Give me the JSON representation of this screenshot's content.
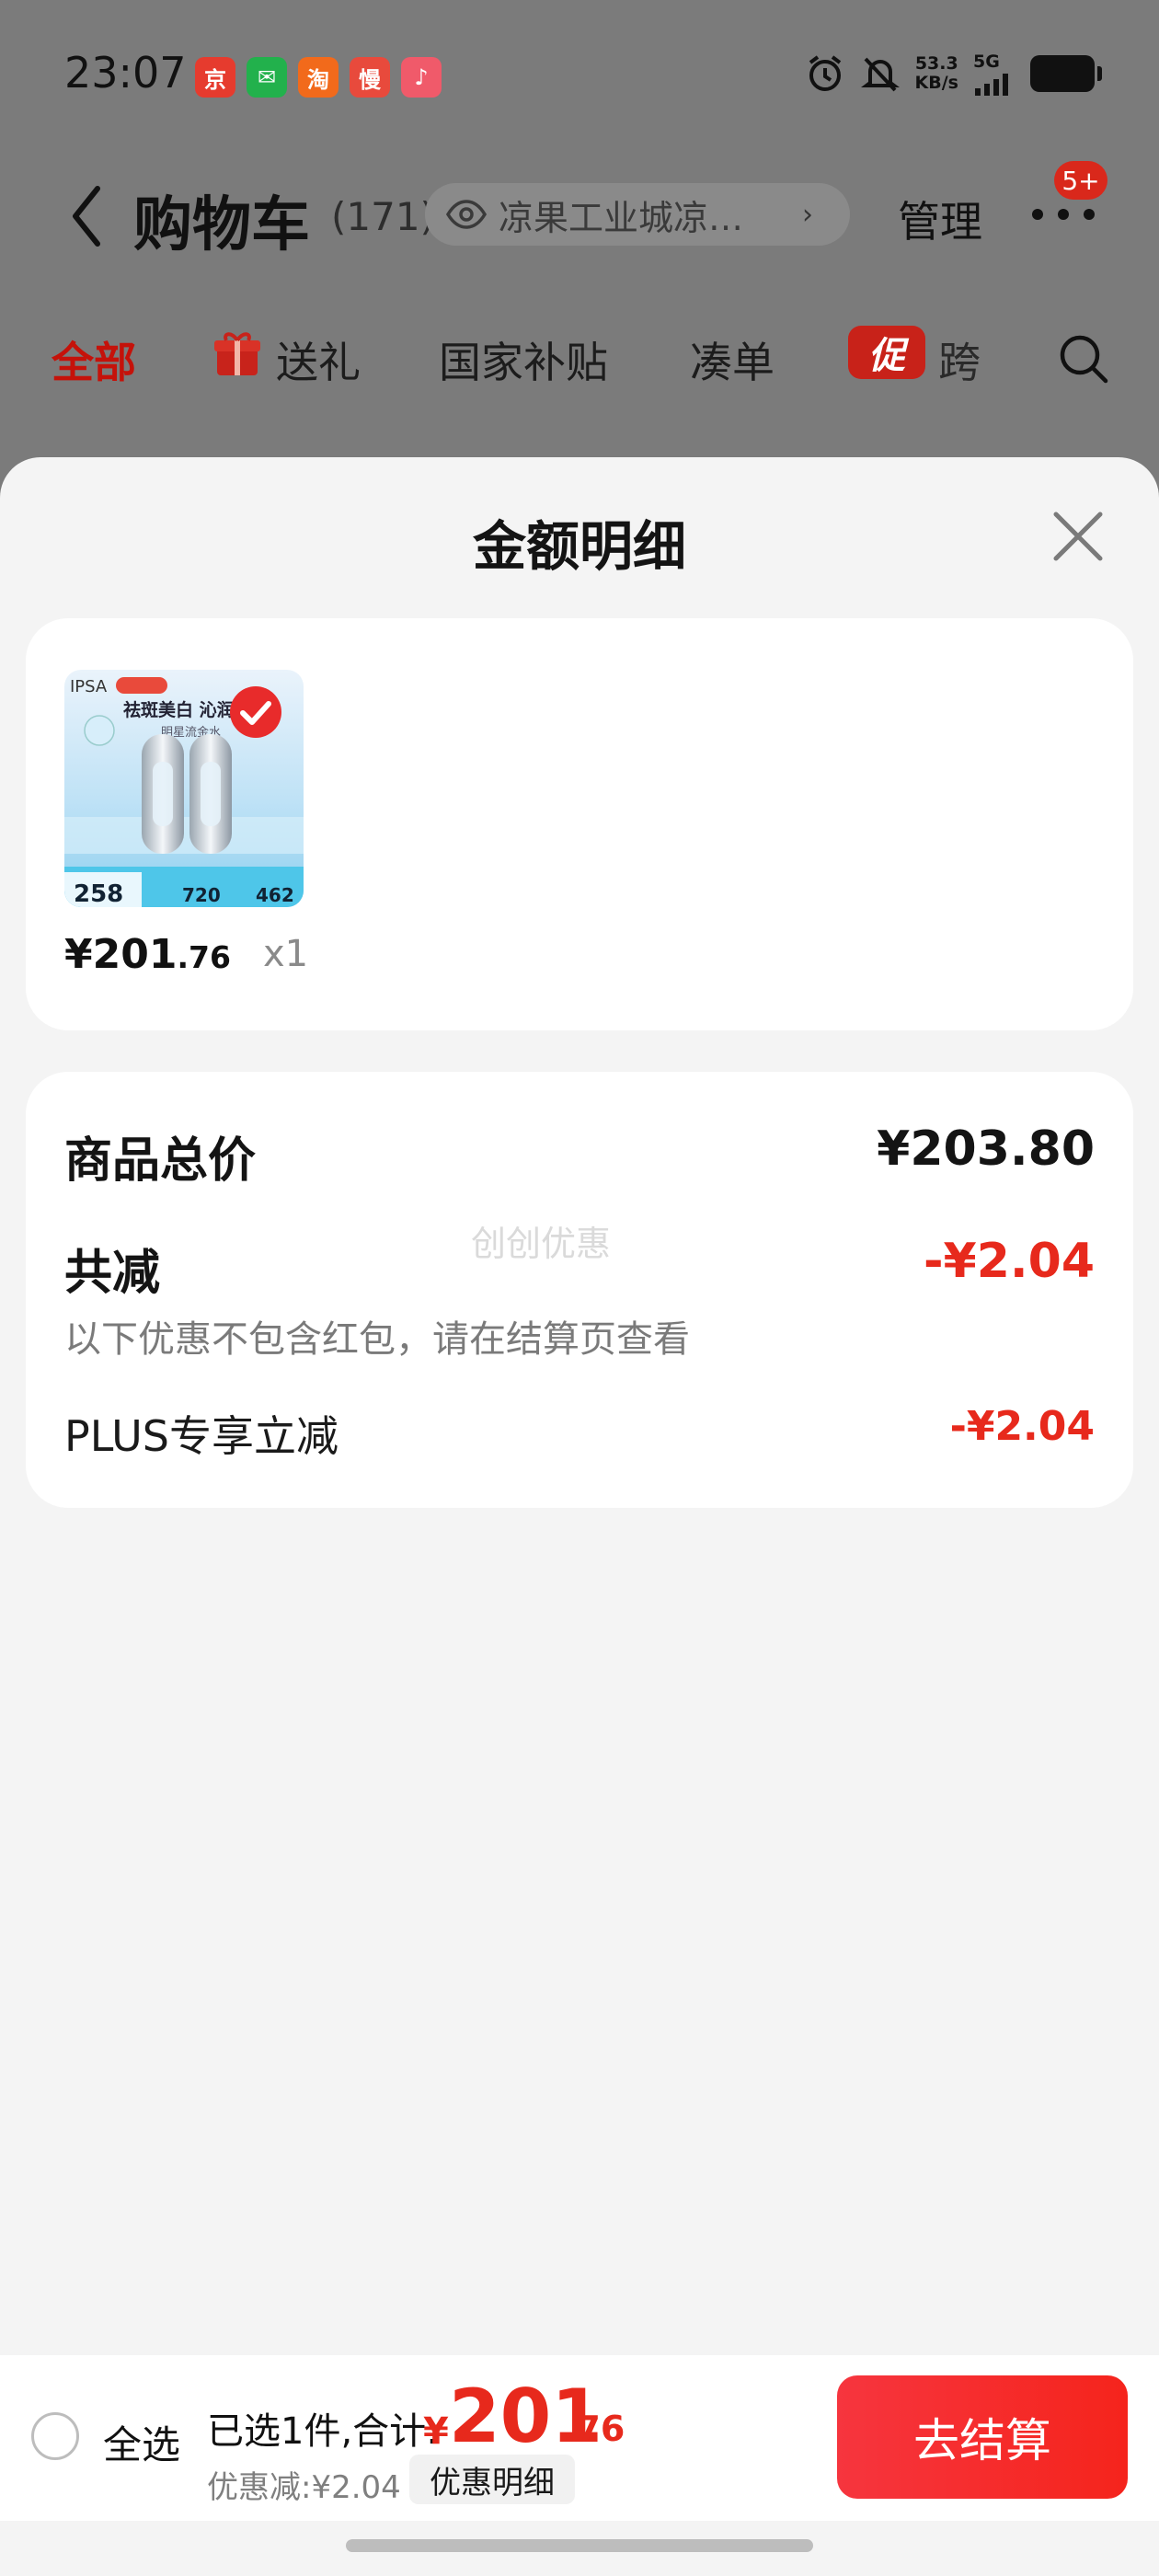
{
  "status_bar": {
    "time": "23:07",
    "app_icons": [
      {
        "name": "jd-icon",
        "glyph": "京",
        "color": "#e63b2e"
      },
      {
        "name": "wechat-icon",
        "glyph": "✉",
        "color": "#22b14c"
      },
      {
        "name": "taobao-icon",
        "glyph": "淘",
        "color": "#f26a1b"
      },
      {
        "name": "app-man-icon",
        "glyph": "慢",
        "color": "#e84a3c"
      },
      {
        "name": "music-icon",
        "glyph": "♪",
        "color": "#f05a6a"
      }
    ],
    "net_speed_value": "53.3",
    "net_speed_unit": "KB/s",
    "network": "5G"
  },
  "nav": {
    "title": "购物车",
    "count": "(171)",
    "location": "凉果工业城凉…",
    "manage": "管理",
    "badge": "5+"
  },
  "tabs": [
    {
      "label": "全部",
      "active": true
    },
    {
      "label": "送礼"
    },
    {
      "label": "国家补贴"
    },
    {
      "label": "凑单"
    },
    {
      "label": "跨"
    }
  ],
  "promo_icon_text": "促",
  "sheet": {
    "title": "金额明细",
    "product": {
      "brand": "IPSA",
      "promo_line": "祛斑美白 沁润保",
      "sub_line": "明星流金水",
      "prices_on_image": [
        "258",
        "720",
        "462"
      ],
      "price_int": "¥201",
      "price_dec": ".76",
      "qty": "x1"
    },
    "summary": {
      "total_label": "商品总价",
      "total_value": "¥203.80",
      "reduce_label": "共减",
      "reduce_value": "-¥2.04",
      "note": "以下优惠不包含红包，请在结算页查看",
      "plus_label": "PLUS专享立减",
      "plus_value": "-¥2.04",
      "watermark": "创创优惠"
    }
  },
  "bottom_bar": {
    "select_all": "全选",
    "summary": "已选1件,合计:",
    "currency": "¥",
    "total_int": "201",
    "total_dec": ".76",
    "discount": "优惠减:¥2.04",
    "detail_btn": "优惠明细",
    "checkout": "去结算"
  }
}
